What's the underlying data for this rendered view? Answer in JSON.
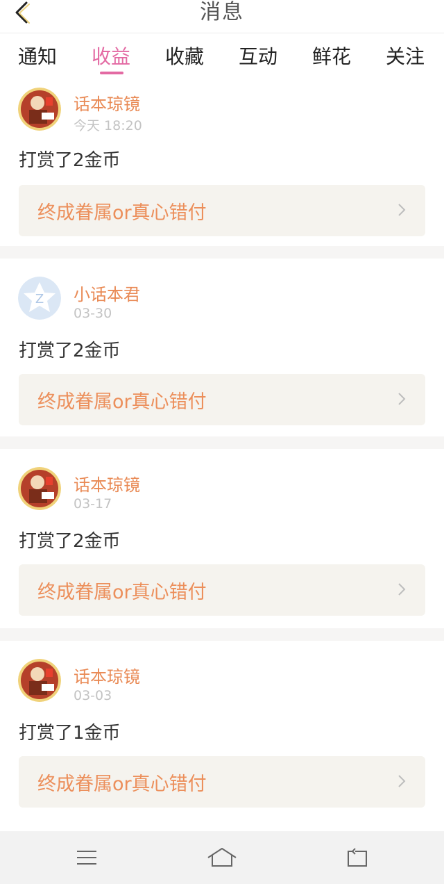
{
  "header": {
    "title": "消息",
    "back_icon": "chevron-left-icon"
  },
  "tabs": [
    {
      "label": "通知",
      "active": false
    },
    {
      "label": "收益",
      "active": true
    },
    {
      "label": "收藏",
      "active": false
    },
    {
      "label": "互动",
      "active": false
    },
    {
      "label": "鲜花",
      "active": false
    },
    {
      "label": "关注",
      "active": false
    }
  ],
  "messages": [
    {
      "user": "话本琼镜",
      "time": "今天 18:20",
      "action": "打赏了2金币",
      "work": "终成眷属or真心错付",
      "avatar": "cartoon-avatar"
    },
    {
      "user": "小话本君",
      "time": "03-30",
      "action": "打赏了2金币",
      "work": "终成眷属or真心错付",
      "avatar": "default-star-avatar"
    },
    {
      "user": "话本琼镜",
      "time": "03-17",
      "action": "打赏了2金币",
      "work": "终成眷属or真心错付",
      "avatar": "cartoon-avatar"
    },
    {
      "user": "话本琼镜",
      "time": "03-03",
      "action": "打赏了1金币",
      "work": "终成眷属or真心错付",
      "avatar": "cartoon-avatar"
    }
  ],
  "navbar": {
    "icons": [
      "menu-icon",
      "home-icon",
      "back-icon"
    ]
  },
  "colors": {
    "accent": "#e36aa3",
    "username": "#e98a55",
    "work_title": "#ec8f5b",
    "card_link_bg": "#f5f3ee"
  }
}
